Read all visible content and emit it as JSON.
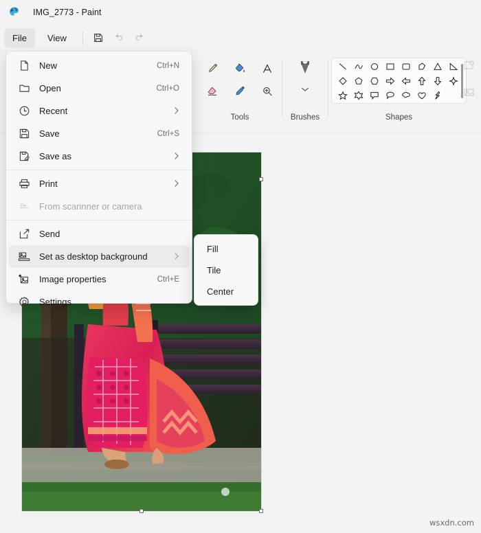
{
  "window": {
    "title": "IMG_2773 - Paint",
    "app_icon": "paint-palette-icon"
  },
  "commandbar": {
    "menus": [
      {
        "label": "File",
        "active": true
      },
      {
        "label": "View",
        "active": false
      }
    ],
    "buttons": [
      {
        "name": "save-button",
        "icon": "floppy-disk-icon",
        "disabled": false
      },
      {
        "name": "undo-button",
        "icon": "undo-arrow-icon",
        "disabled": true
      },
      {
        "name": "redo-button",
        "icon": "redo-arrow-icon",
        "disabled": true
      }
    ]
  },
  "ribbon": {
    "groups": [
      {
        "name": "tools",
        "label": "Tools",
        "items": [
          {
            "name": "pencil-tool",
            "icon": "pencil-icon"
          },
          {
            "name": "fill-tool",
            "icon": "paint-bucket-icon"
          },
          {
            "name": "text-tool",
            "icon": "text-a-icon"
          },
          {
            "name": "eraser-tool",
            "icon": "eraser-icon"
          },
          {
            "name": "color-picker-tool",
            "icon": "eyedropper-icon"
          },
          {
            "name": "magnifier-tool",
            "icon": "magnifier-plus-icon"
          }
        ]
      },
      {
        "name": "brushes",
        "label": "Brushes",
        "items": [
          {
            "name": "brushes-button",
            "icon": "paintbrush-icon"
          },
          {
            "name": "brushes-expand",
            "icon": "chevron-down-icon"
          }
        ]
      },
      {
        "name": "shapes",
        "label": "Shapes",
        "items": [
          {
            "name": "shape-line",
            "icon": "line-icon"
          },
          {
            "name": "shape-curve",
            "icon": "curve-icon"
          },
          {
            "name": "shape-oval",
            "icon": "oval-icon"
          },
          {
            "name": "shape-rectangle",
            "icon": "rectangle-icon"
          },
          {
            "name": "shape-rounded-rectangle",
            "icon": "rounded-rectangle-icon"
          },
          {
            "name": "shape-polygon",
            "icon": "polygon-icon"
          },
          {
            "name": "shape-triangle",
            "icon": "triangle-icon"
          },
          {
            "name": "shape-right-triangle",
            "icon": "right-triangle-icon"
          },
          {
            "name": "shape-diamond",
            "icon": "diamond-icon"
          },
          {
            "name": "shape-pentagon",
            "icon": "pentagon-icon"
          },
          {
            "name": "shape-hexagon",
            "icon": "hexagon-icon"
          },
          {
            "name": "shape-right-arrow",
            "icon": "right-arrow-icon"
          },
          {
            "name": "shape-left-arrow",
            "icon": "left-arrow-icon"
          },
          {
            "name": "shape-up-arrow",
            "icon": "up-arrow-icon"
          },
          {
            "name": "shape-down-arrow",
            "icon": "down-arrow-icon"
          },
          {
            "name": "shape-four-point-star",
            "icon": "four-point-star-icon"
          },
          {
            "name": "shape-five-point-star",
            "icon": "five-point-star-icon"
          },
          {
            "name": "shape-six-point-star",
            "icon": "six-point-star-icon"
          },
          {
            "name": "shape-rectangular-callout",
            "icon": "rectangular-callout-icon"
          },
          {
            "name": "shape-rounded-callout",
            "icon": "rounded-callout-icon"
          },
          {
            "name": "shape-cloud-callout",
            "icon": "cloud-callout-icon"
          },
          {
            "name": "shape-heart",
            "icon": "heart-icon"
          },
          {
            "name": "shape-lightning",
            "icon": "lightning-icon"
          }
        ]
      }
    ],
    "right_icons": [
      {
        "name": "edit-with-paint-3d-icon",
        "icon": "edit-square-icon"
      },
      {
        "name": "layers-icon",
        "icon": "image-layers-icon"
      }
    ]
  },
  "file_menu": {
    "items": [
      {
        "label": "New",
        "accel": "Ctrl+N",
        "icon": "new-page-icon",
        "chevron": false,
        "disabled": false,
        "selected": false
      },
      {
        "label": "Open",
        "accel": "Ctrl+O",
        "icon": "folder-open-icon",
        "chevron": false,
        "disabled": false,
        "selected": false
      },
      {
        "label": "Recent",
        "accel": "",
        "icon": "clock-icon",
        "chevron": true,
        "disabled": false,
        "selected": false
      },
      {
        "label": "Save",
        "accel": "Ctrl+S",
        "icon": "floppy-disk-icon",
        "chevron": false,
        "disabled": false,
        "selected": false
      },
      {
        "label": "Save as",
        "accel": "",
        "icon": "save-as-pencil-icon",
        "chevron": true,
        "disabled": false,
        "selected": false
      },
      {
        "label": "Print",
        "accel": "",
        "icon": "printer-icon",
        "chevron": true,
        "disabled": false,
        "selected": false
      },
      {
        "label": "From scannner or camera",
        "accel": "",
        "icon": "scanner-icon",
        "chevron": false,
        "disabled": true,
        "selected": false
      },
      {
        "label": "Send",
        "accel": "",
        "icon": "share-arrow-icon",
        "chevron": false,
        "disabled": false,
        "selected": false
      },
      {
        "label": "Set as desktop background",
        "accel": "",
        "icon": "desktop-image-icon",
        "chevron": true,
        "disabled": false,
        "selected": true
      },
      {
        "label": "Image properties",
        "accel": "Ctrl+E",
        "icon": "image-properties-icon",
        "chevron": false,
        "disabled": false,
        "selected": false
      },
      {
        "label": "Settings",
        "accel": "",
        "icon": "gear-icon",
        "chevron": false,
        "disabled": false,
        "selected": false
      }
    ],
    "dividers_after": [
      4,
      5,
      6
    ]
  },
  "submenu": {
    "parent": "Set as desktop background",
    "items": [
      {
        "label": "Fill"
      },
      {
        "label": "Tile"
      },
      {
        "label": "Center"
      }
    ]
  },
  "canvas": {
    "image_description": "Woman in pink and red saree seated on a dark wooden bench in front of dense green foliage",
    "selection_handles": 4
  },
  "watermark": {
    "text": "wsxdn.com"
  },
  "colors": {
    "window_background": "#f3f3f3",
    "menu_background": "#f7f7f7",
    "menu_selected": "#ebebeb",
    "text_primary": "#1b1b1b",
    "text_secondary": "#6b6b6b",
    "text_disabled": "#a6a6a6",
    "divider": "#e5e5e5"
  }
}
